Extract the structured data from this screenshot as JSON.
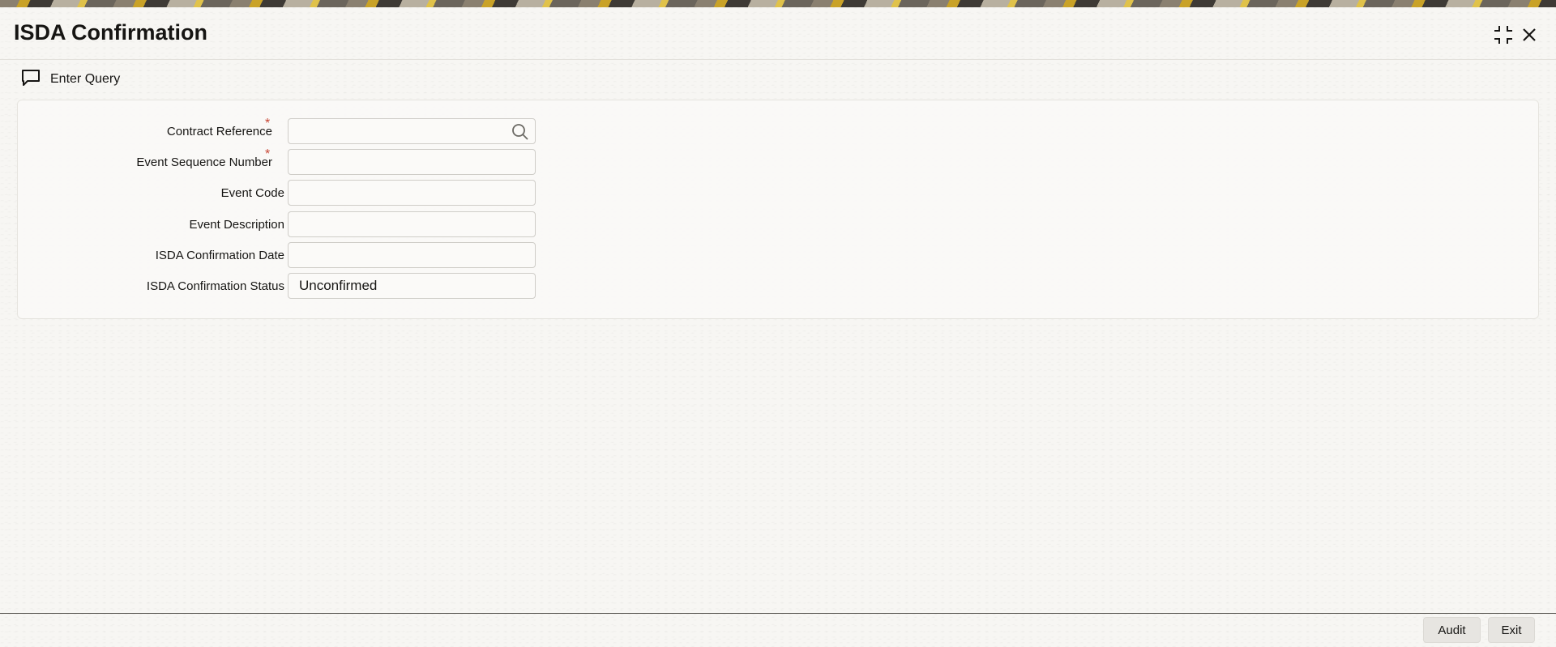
{
  "header": {
    "title": "ISDA Confirmation",
    "icons": [
      "expand-icon",
      "close-icon"
    ]
  },
  "toolbar": {
    "enter_query_label": "Enter Query",
    "enter_query_icon": "speech-bubble-icon"
  },
  "form": {
    "fields": [
      {
        "label": "Contract Reference",
        "value": "",
        "required": true,
        "has_search": true
      },
      {
        "label": "Event Sequence Number",
        "value": "",
        "required": true
      },
      {
        "label": "Event Code",
        "value": ""
      },
      {
        "label": "Event Description",
        "value": ""
      },
      {
        "label": "ISDA Confirmation Date",
        "value": ""
      },
      {
        "label": "ISDA Confirmation Status",
        "value": "Unconfirmed"
      }
    ],
    "required_marker": "*"
  },
  "footer": {
    "audit_label": "Audit",
    "exit_label": "Exit"
  },
  "colors": {
    "required": "#c74634",
    "text": "#161513",
    "background": "#f7f6f3"
  }
}
